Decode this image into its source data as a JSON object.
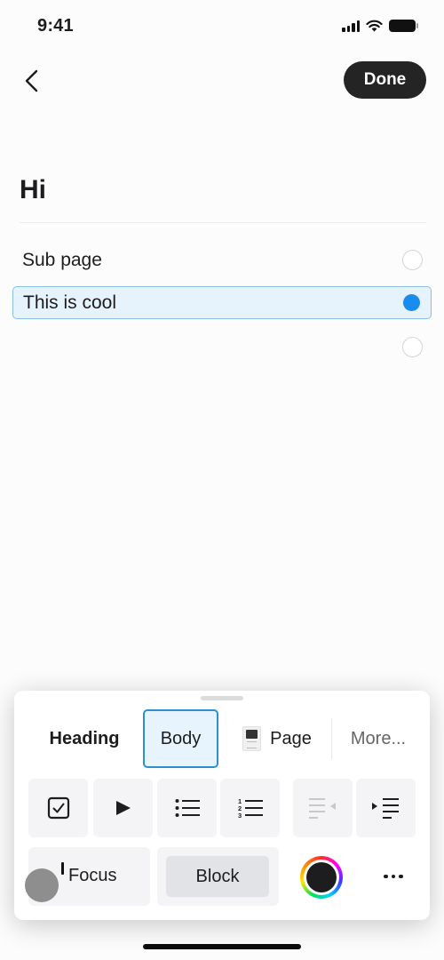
{
  "status_bar": {
    "time": "9:41",
    "icons": [
      "cellular-signal-icon",
      "wifi-icon",
      "battery-icon"
    ]
  },
  "nav": {
    "back_icon": "chevron-left-icon",
    "done_label": "Done"
  },
  "page": {
    "title": "Hi",
    "blocks": [
      {
        "label": "Sub page",
        "selected": false
      },
      {
        "label": "This is cool",
        "selected": true
      },
      {
        "label": "",
        "selected": false
      }
    ]
  },
  "toolbar": {
    "styles": {
      "heading": "Heading",
      "body": "Body",
      "page": "Page",
      "more": "More...",
      "active": "Body"
    },
    "format_buttons": [
      {
        "name": "checkbox",
        "icon": "checkbox-icon",
        "enabled": true
      },
      {
        "name": "toggle",
        "icon": "play-triangle-icon",
        "enabled": true
      },
      {
        "name": "bulleted-list",
        "icon": "bullet-list-icon",
        "enabled": true
      },
      {
        "name": "numbered-list",
        "icon": "numbered-list-icon",
        "enabled": true
      },
      {
        "name": "outdent",
        "icon": "outdent-icon",
        "enabled": false
      },
      {
        "name": "indent",
        "icon": "indent-icon",
        "enabled": true
      }
    ],
    "focus_label": "Focus",
    "block_label": "Block",
    "color_icon": "color-wheel-icon",
    "current_color": "#1d1d1f",
    "more_icon": "ellipsis-icon"
  },
  "colors": {
    "accent": "#1a8cf0",
    "selected_bg": "#e6f3fc",
    "selected_border": "#8bc0dc",
    "done_bg": "#242424"
  }
}
